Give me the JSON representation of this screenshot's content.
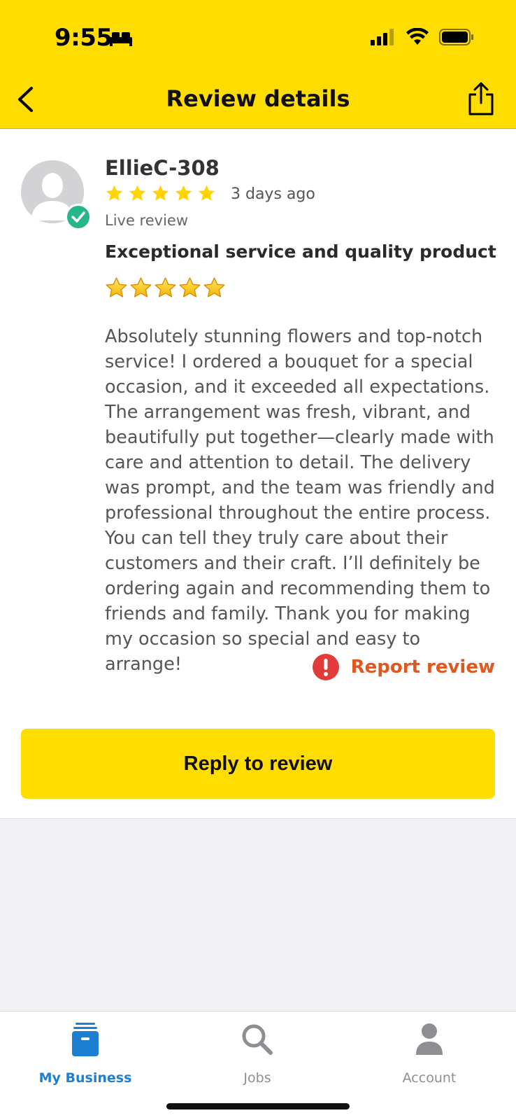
{
  "status_bar": {
    "time": "9:55"
  },
  "header": {
    "title": "Review details"
  },
  "review": {
    "reviewer_name": "EllieC-308",
    "rating_stars": 5,
    "time_ago": "3 days ago",
    "status": "Live review",
    "title": "Exceptional service and quality product",
    "emoji_stars": "⭐⭐⭐⭐⭐",
    "body": "Absolutely stunning flowers and top-notch service! I ordered a bouquet for a special occasion, and it exceeded all expectations. The arrangement was fresh, vibrant, and beautifully put together—clearly made with care and attention to detail. The delivery was prompt, and the team was friendly and professional throughout the entire process. You can tell they truly care about their customers and their craft. I’ll definitely be ordering again and recommending them to friends and family. Thank you for making my occasion so special and easy to arrange!",
    "report_label": "Report review"
  },
  "actions": {
    "reply_label": "Reply to review"
  },
  "tabbar": {
    "tabs": [
      {
        "label": "My Business",
        "icon": "business-box-icon",
        "active": true
      },
      {
        "label": "Jobs",
        "icon": "search-icon",
        "active": false
      },
      {
        "label": "Account",
        "icon": "person-icon",
        "active": false
      }
    ]
  },
  "colors": {
    "brand_yellow": "#ffdd00",
    "star_yellow": "#ffd400",
    "verified_green": "#27b58a",
    "report_orange": "#e2571e",
    "alert_red": "#e23b3b",
    "tab_active_blue": "#1d7fd1",
    "tab_inactive_gray": "#8e8e93"
  }
}
